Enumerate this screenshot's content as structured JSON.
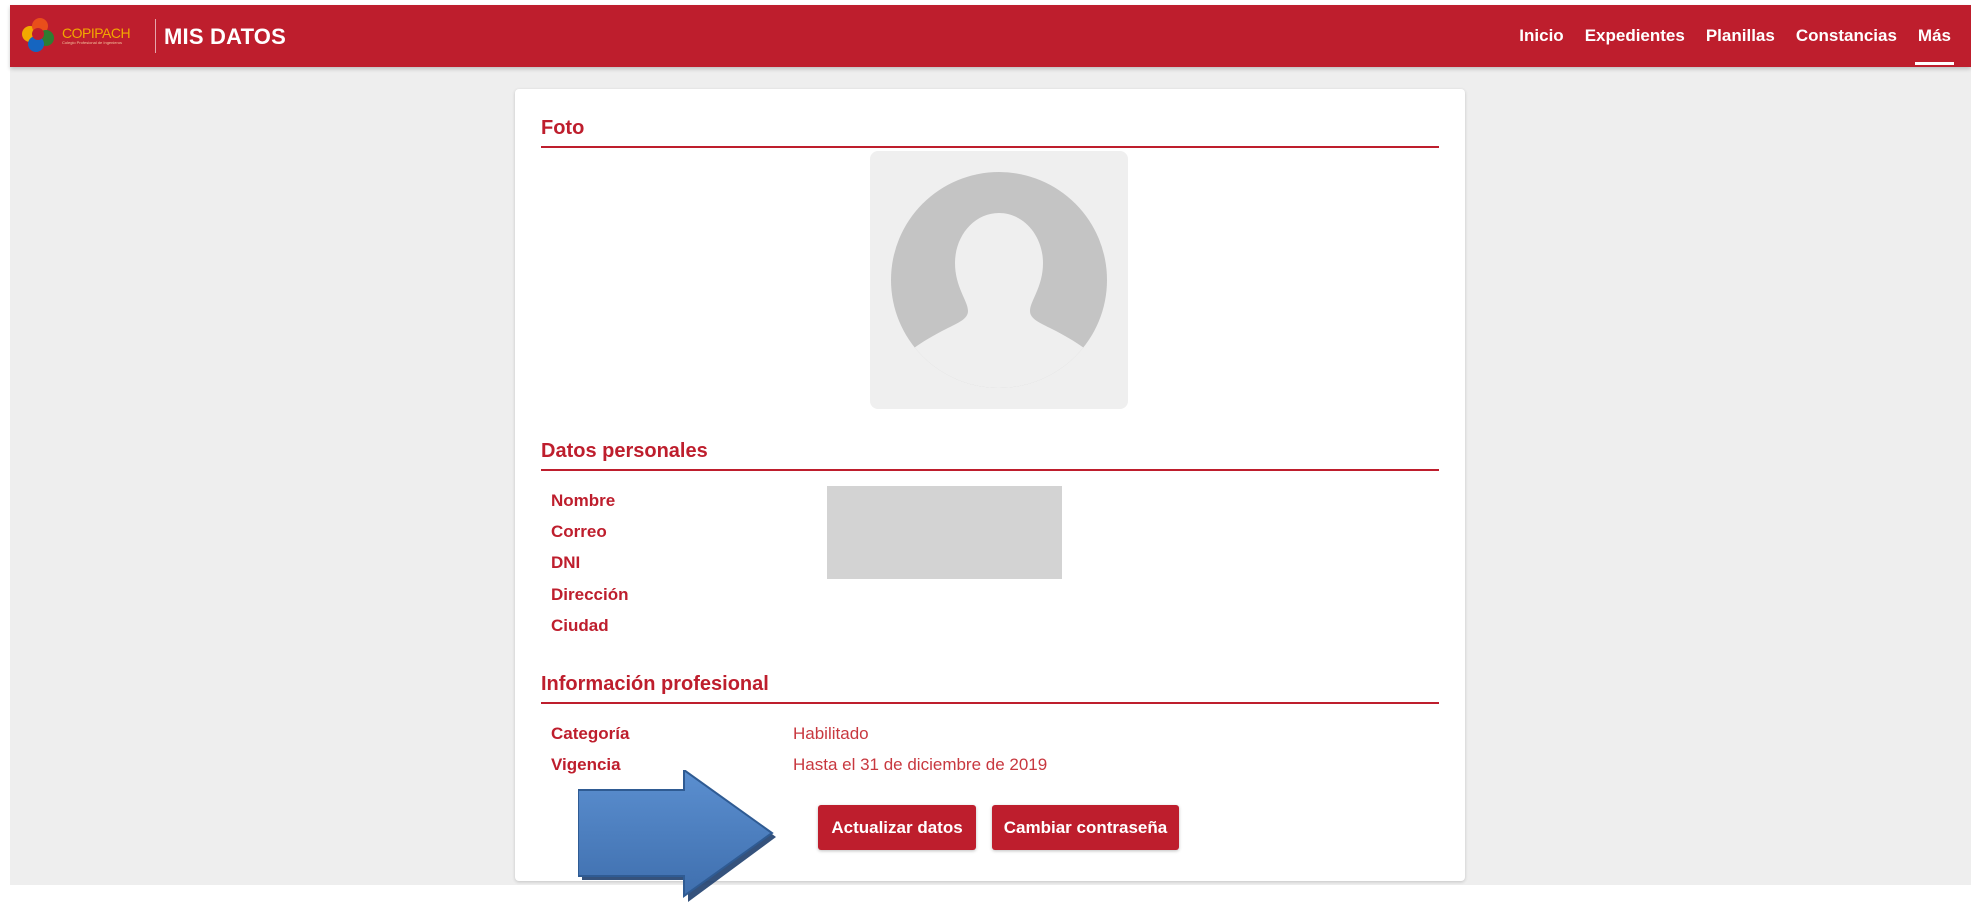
{
  "header": {
    "logo_text": "COPIPACH",
    "logo_subtitle": "Colegio Profesional de Ingenieros",
    "title": "MIS DATOS",
    "nav": [
      {
        "label": "Inicio"
      },
      {
        "label": "Expedientes"
      },
      {
        "label": "Planillas"
      },
      {
        "label": "Constancias"
      },
      {
        "label": "Más",
        "active": true
      }
    ],
    "color": "#be1e2d"
  },
  "foto": {
    "title": "Foto",
    "avatar_icon": "person-silhouette-icon"
  },
  "datos_personales": {
    "title": "Datos personales",
    "fields": [
      {
        "label": "Nombre",
        "value": ""
      },
      {
        "label": "Correo",
        "value": ""
      },
      {
        "label": "DNI",
        "value": ""
      },
      {
        "label": "Dirección",
        "value": ""
      },
      {
        "label": "Ciudad",
        "value": ""
      }
    ]
  },
  "informacion_profesional": {
    "title": "Información profesional",
    "fields": [
      {
        "label": "Categoría",
        "value": "Habilitado"
      },
      {
        "label": "Vigencia",
        "value": "Hasta el 31 de diciembre de 2019"
      }
    ]
  },
  "actions": {
    "update_label": "Actualizar datos",
    "change_password_label": "Cambiar contraseña"
  },
  "annotation": {
    "arrow_icon": "right-arrow-icon",
    "arrow_color": "#4a7ebf"
  }
}
